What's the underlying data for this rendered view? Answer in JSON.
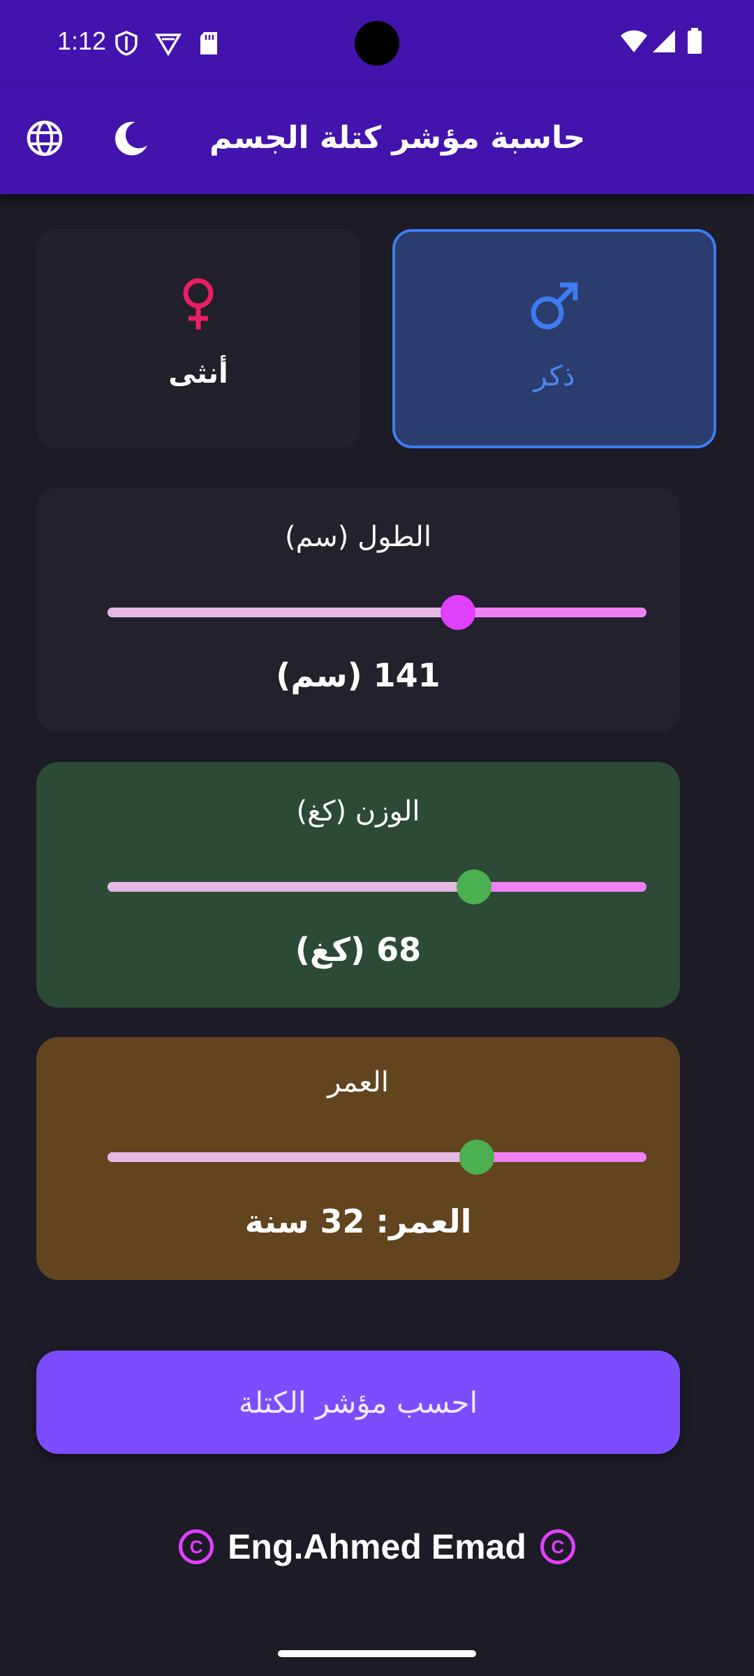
{
  "status_bar": {
    "time": "1:12"
  },
  "app_bar": {
    "title": "حاسبة مؤشر كتلة الجسم",
    "icons": [
      "globe-icon",
      "moon-icon"
    ]
  },
  "gender": {
    "female_label": "أنثى",
    "male_label": "ذكر",
    "selected": "male",
    "colors": {
      "female": "#e91e63",
      "male": "#3d7cf0"
    }
  },
  "height": {
    "label": "الطول (سم)",
    "value_text": "141  (سم)",
    "slider_fraction": 0.65,
    "thumb_color": "#e040fb"
  },
  "weight": {
    "label": "الوزن (كغ)",
    "value_text": "68  (كغ)",
    "slider_fraction": 0.68,
    "thumb_color": "#4caf50"
  },
  "age": {
    "label": "العمر",
    "value_text": "العمر: 32 سنة",
    "slider_fraction": 0.685,
    "thumb_color": "#4caf50"
  },
  "calculate_button": {
    "label": "احسب مؤشر الكتلة"
  },
  "footer": {
    "author": "Eng.Ahmed Emad",
    "copyright_symbol": "C"
  }
}
